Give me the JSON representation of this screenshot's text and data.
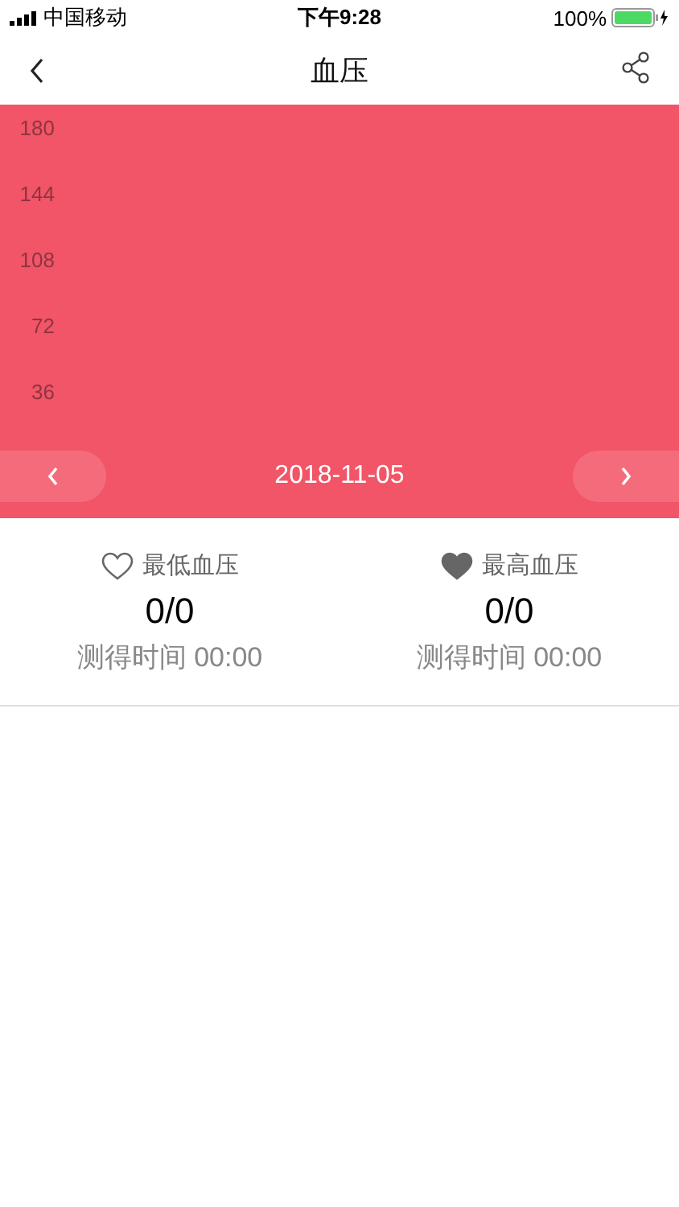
{
  "status_bar": {
    "carrier": "中国移动",
    "time": "下午9:28",
    "battery": "100%"
  },
  "nav": {
    "title": "血压"
  },
  "chart": {
    "y_labels": [
      "180",
      "144",
      "108",
      "72",
      "36"
    ]
  },
  "date_bar": {
    "date": "2018-11-05"
  },
  "stats": [
    {
      "filled": false,
      "label": "最低血压",
      "value": "0/0",
      "time": "测得时间 00:00"
    },
    {
      "filled": true,
      "label": "最高血压",
      "value": "0/0",
      "time": "测得时间 00:00"
    }
  ]
}
